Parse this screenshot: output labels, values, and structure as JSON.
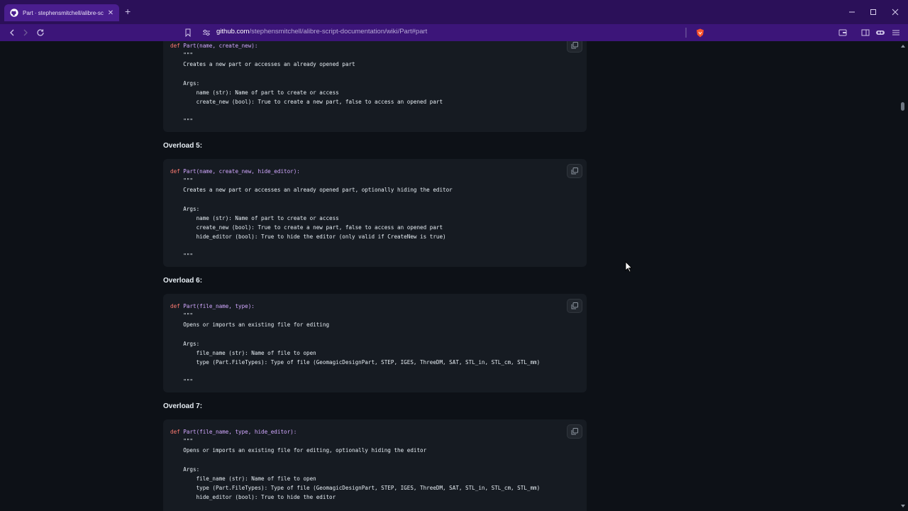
{
  "browser": {
    "tab_title": "Part · stephensmitchell/alibre-sc",
    "url_host": "github.com",
    "url_path": "/stephensmitchell/alibre-script-documentation/wiki/Part#part",
    "accent": "#3c1579"
  },
  "blocks": [
    {
      "heading": null,
      "signature": "Part(name, create_new):",
      "lines": [
        "    \"\"\"",
        "    Creates a new part or accesses an already opened part",
        "",
        "    Args:",
        "        name (str): Name of part to create or access",
        "        create_new (bool): True to create a new part, false to access an opened part",
        "",
        "    \"\"\""
      ]
    },
    {
      "heading": "Overload 5:",
      "signature": "Part(name, create_new, hide_editor):",
      "lines": [
        "    \"\"\"",
        "    Creates a new part or accesses an already opened part, optionally hiding the editor",
        "",
        "    Args:",
        "        name (str): Name of part to create or access",
        "        create_new (bool): True to create a new part, false to access an opened part",
        "        hide_editor (bool): True to hide the editor (only valid if CreateNew is true)",
        "",
        "    \"\"\""
      ]
    },
    {
      "heading": "Overload 6:",
      "signature": "Part(file_name, type):",
      "lines": [
        "    \"\"\"",
        "    Opens or imports an existing file for editing",
        "",
        "    Args:",
        "        file_name (str): Name of file to open",
        "        type (Part.FileTypes): Type of file (GeomagicDesignPart, STEP, IGES, ThreeDM, SAT, STL_in, STL_cm, STL_mm)",
        "",
        "    \"\"\""
      ]
    },
    {
      "heading": "Overload 7:",
      "signature": "Part(file_name, type, hide_editor):",
      "lines": [
        "    \"\"\"",
        "    Opens or imports an existing file for editing, optionally hiding the editor",
        "",
        "    Args:",
        "        file_name (str): Name of file to open",
        "        type (Part.FileTypes): Type of file (GeomagicDesignPart, STEP, IGES, ThreeDM, SAT, STL_in, STL_cm, STL_mm)",
        "        hide_editor (bool): True to hide the editor"
      ]
    }
  ],
  "code_keyword": "def"
}
